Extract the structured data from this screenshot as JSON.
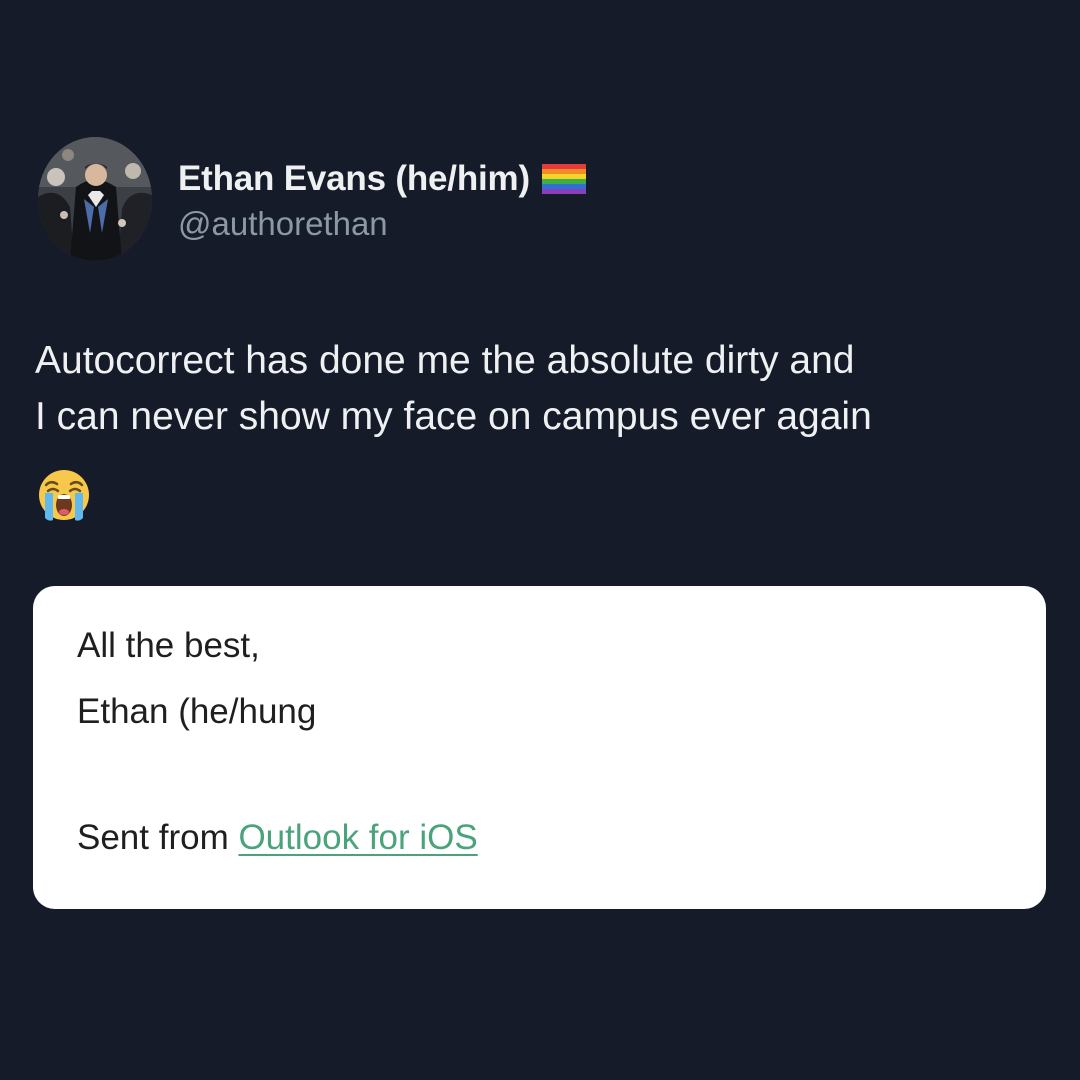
{
  "tweet": {
    "author": {
      "display_name": "Ethan Evans (he/him)",
      "handle": "@authorethan",
      "avatar_icon": "avatar-graduation-photo",
      "badge_icon": "rainbow-flag-icon"
    },
    "text": "Autocorrect has done me the absolute dirty and\nI can never show my face on campus ever again",
    "emoji_icon": "loudly-crying-face-icon"
  },
  "email_signature": {
    "greeting": "All the best,",
    "name_line": "Ethan (he/hung",
    "sent_prefix": "Sent from ",
    "sent_link": "Outlook for iOS",
    "link_color": "#4aa37a"
  },
  "colors": {
    "background": "#151b28",
    "card": "#ffffff",
    "handle": "#8b98a5"
  }
}
